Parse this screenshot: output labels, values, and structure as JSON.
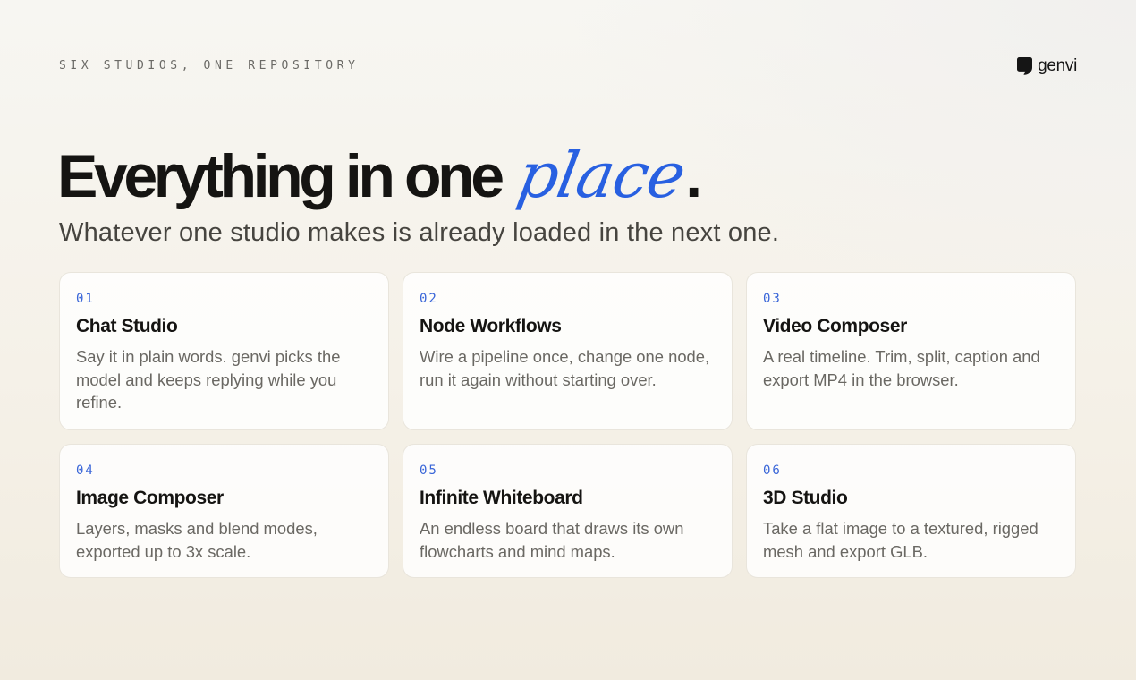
{
  "header": {
    "eyebrow": "SIX STUDIOS, ONE REPOSITORY",
    "brand_name": "genvi",
    "brand_icon": "speech-bubble-icon"
  },
  "hero": {
    "headline_main": "Everything in one",
    "headline_accent": "place",
    "headline_end": ".",
    "subhead": "Whatever one studio makes is already loaded in the next one."
  },
  "cards": [
    {
      "number": "01",
      "title": "Chat Studio",
      "description": "Say it in plain words. genvi picks the model and keeps replying while you refine."
    },
    {
      "number": "02",
      "title": "Node Workflows",
      "description": "Wire a pipeline once, change one node, run it again without starting over."
    },
    {
      "number": "03",
      "title": "Video Composer",
      "description": "A real timeline. Trim, split, caption and export MP4 in the browser."
    },
    {
      "number": "04",
      "title": "Image Composer",
      "description": "Layers, masks and blend modes, exported up to 3x scale."
    },
    {
      "number": "05",
      "title": "Infinite Whiteboard",
      "description": "An endless board that draws its own flowcharts and mind maps."
    },
    {
      "number": "06",
      "title": "3D Studio",
      "description": "Take a flat image to a textured, rigged mesh and export GLB."
    }
  ],
  "colors": {
    "accent": "#2860e1",
    "card_number": "#3a66d8",
    "text_primary": "#151412",
    "text_secondary": "#6a6863"
  }
}
